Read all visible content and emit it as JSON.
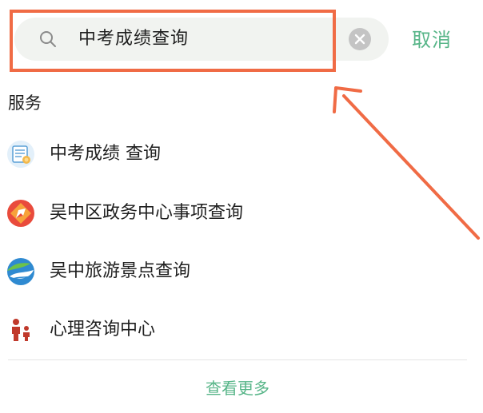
{
  "search": {
    "query": "中考成绩查询",
    "cancel_label": "取消"
  },
  "section": {
    "title": "服务"
  },
  "services": [
    {
      "label": "中考成绩 查询",
      "icon": "certificate-icon"
    },
    {
      "label": "吴中区政务中心事项查询",
      "icon": "compass-diamond-icon"
    },
    {
      "label": "吴中旅游景点查询",
      "icon": "travel-landscape-icon"
    },
    {
      "label": "心理咨询中心",
      "icon": "family-people-icon"
    }
  ],
  "more_label": "查看更多",
  "colors": {
    "accent": "#57b588",
    "highlight": "#f06b45"
  }
}
